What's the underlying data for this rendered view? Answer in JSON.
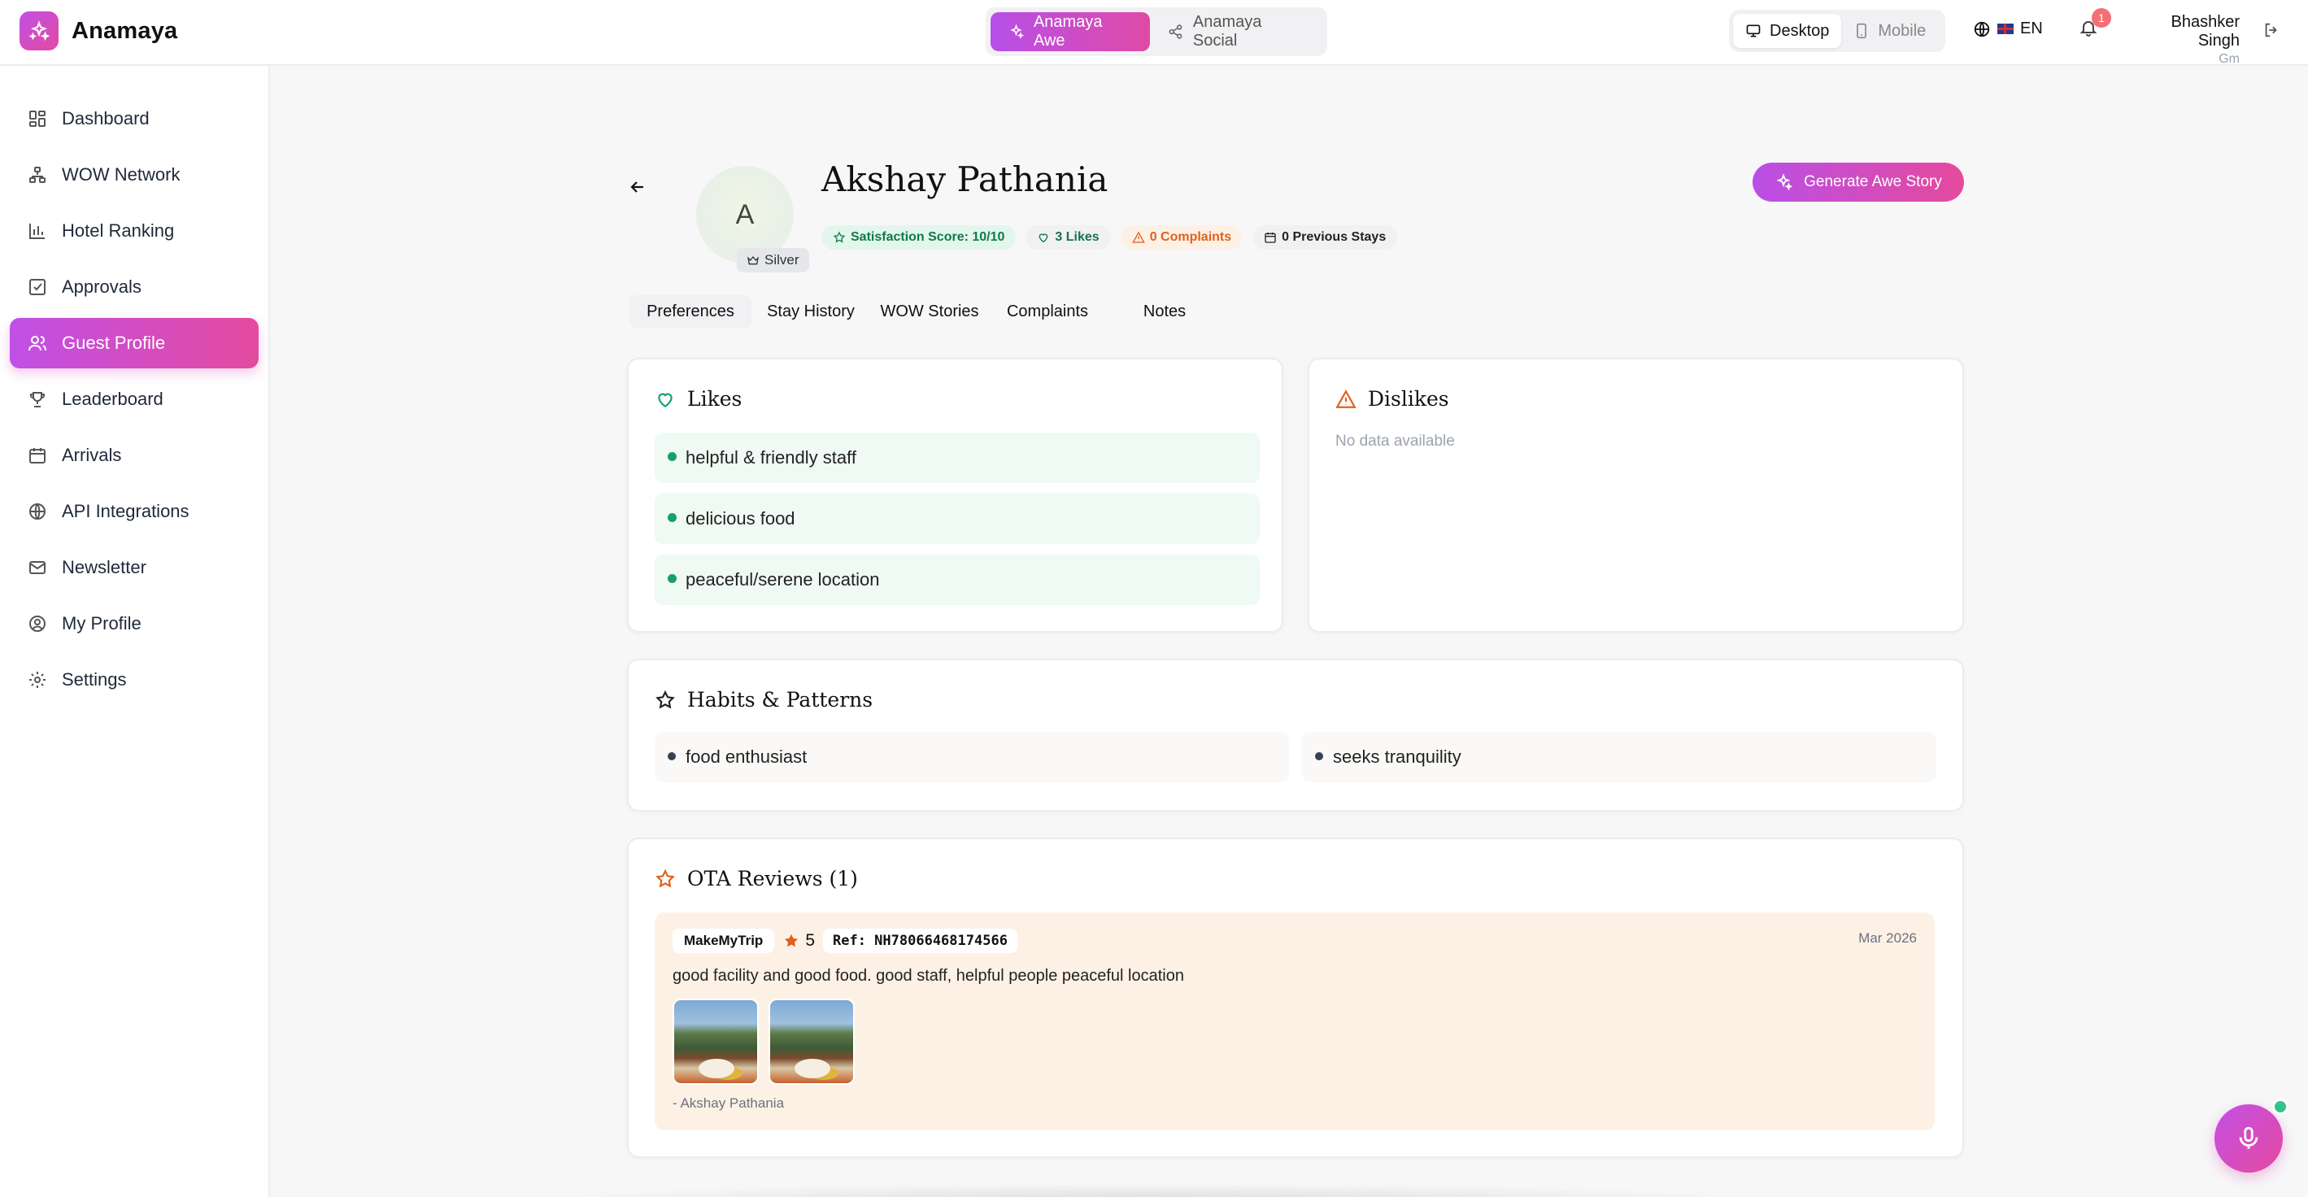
{
  "app": {
    "name": "Anamaya"
  },
  "header": {
    "modes": [
      {
        "label": "Anamaya Awe",
        "active": true,
        "icon": "sparkles-icon"
      },
      {
        "label": "Anamaya Social",
        "active": false,
        "icon": "share-icon"
      }
    ],
    "devices": [
      {
        "label": "Desktop",
        "active": true,
        "icon": "monitor-icon"
      },
      {
        "label": "Mobile",
        "active": false,
        "icon": "smartphone-icon"
      }
    ],
    "language": "EN",
    "notification_count": "1",
    "user": {
      "name": "Bhashker Singh",
      "role": "Gm"
    }
  },
  "sidebar": {
    "items": [
      {
        "label": "Dashboard",
        "icon": "dashboard-icon"
      },
      {
        "label": "WOW Network",
        "icon": "network-icon"
      },
      {
        "label": "Hotel Ranking",
        "icon": "bar-chart-icon"
      },
      {
        "label": "Approvals",
        "icon": "checkbox-icon"
      },
      {
        "label": "Guest Profile",
        "icon": "users-icon",
        "active": true
      },
      {
        "label": "Leaderboard",
        "icon": "trophy-icon"
      },
      {
        "label": "Arrivals",
        "icon": "calendar-icon"
      },
      {
        "label": "API Integrations",
        "icon": "globe-icon"
      },
      {
        "label": "Newsletter",
        "icon": "mail-icon"
      },
      {
        "label": "My Profile",
        "icon": "user-circle-icon"
      },
      {
        "label": "Settings",
        "icon": "gear-icon"
      }
    ]
  },
  "guest": {
    "initial": "A",
    "tier": "Silver",
    "name": "Akshay Pathania",
    "stats": {
      "satisfaction": "Satisfaction Score: 10/10",
      "likes": "3 Likes",
      "complaints": "0 Complaints",
      "stays": "0 Previous Stays"
    },
    "generate_label": "Generate Awe Story"
  },
  "tabs": [
    "Preferences",
    "Stay History",
    "WOW Stories",
    "Complaints",
    "Notes"
  ],
  "likes": {
    "title": "Likes",
    "items": [
      "helpful & friendly staff",
      "delicious food",
      "peaceful/serene location"
    ]
  },
  "dislikes": {
    "title": "Dislikes",
    "empty": "No data available"
  },
  "habits": {
    "title": "Habits & Patterns",
    "items": [
      "food enthusiast",
      "seeks tranquility"
    ]
  },
  "reviews": {
    "title": "OTA Reviews (1)",
    "items": [
      {
        "source": "MakeMyTrip",
        "rating": "5",
        "ref": "Ref: NH78066468174566",
        "date": "Mar 2026",
        "text": "good facility and good food. good staff, helpful people peaceful location",
        "author": "- Akshay Pathania"
      }
    ]
  },
  "colors": {
    "accent_start": "#b94fe7",
    "accent_end": "#e54a9c",
    "like_bg": "#eefaf3",
    "review_bg": "#fdf1e6"
  }
}
